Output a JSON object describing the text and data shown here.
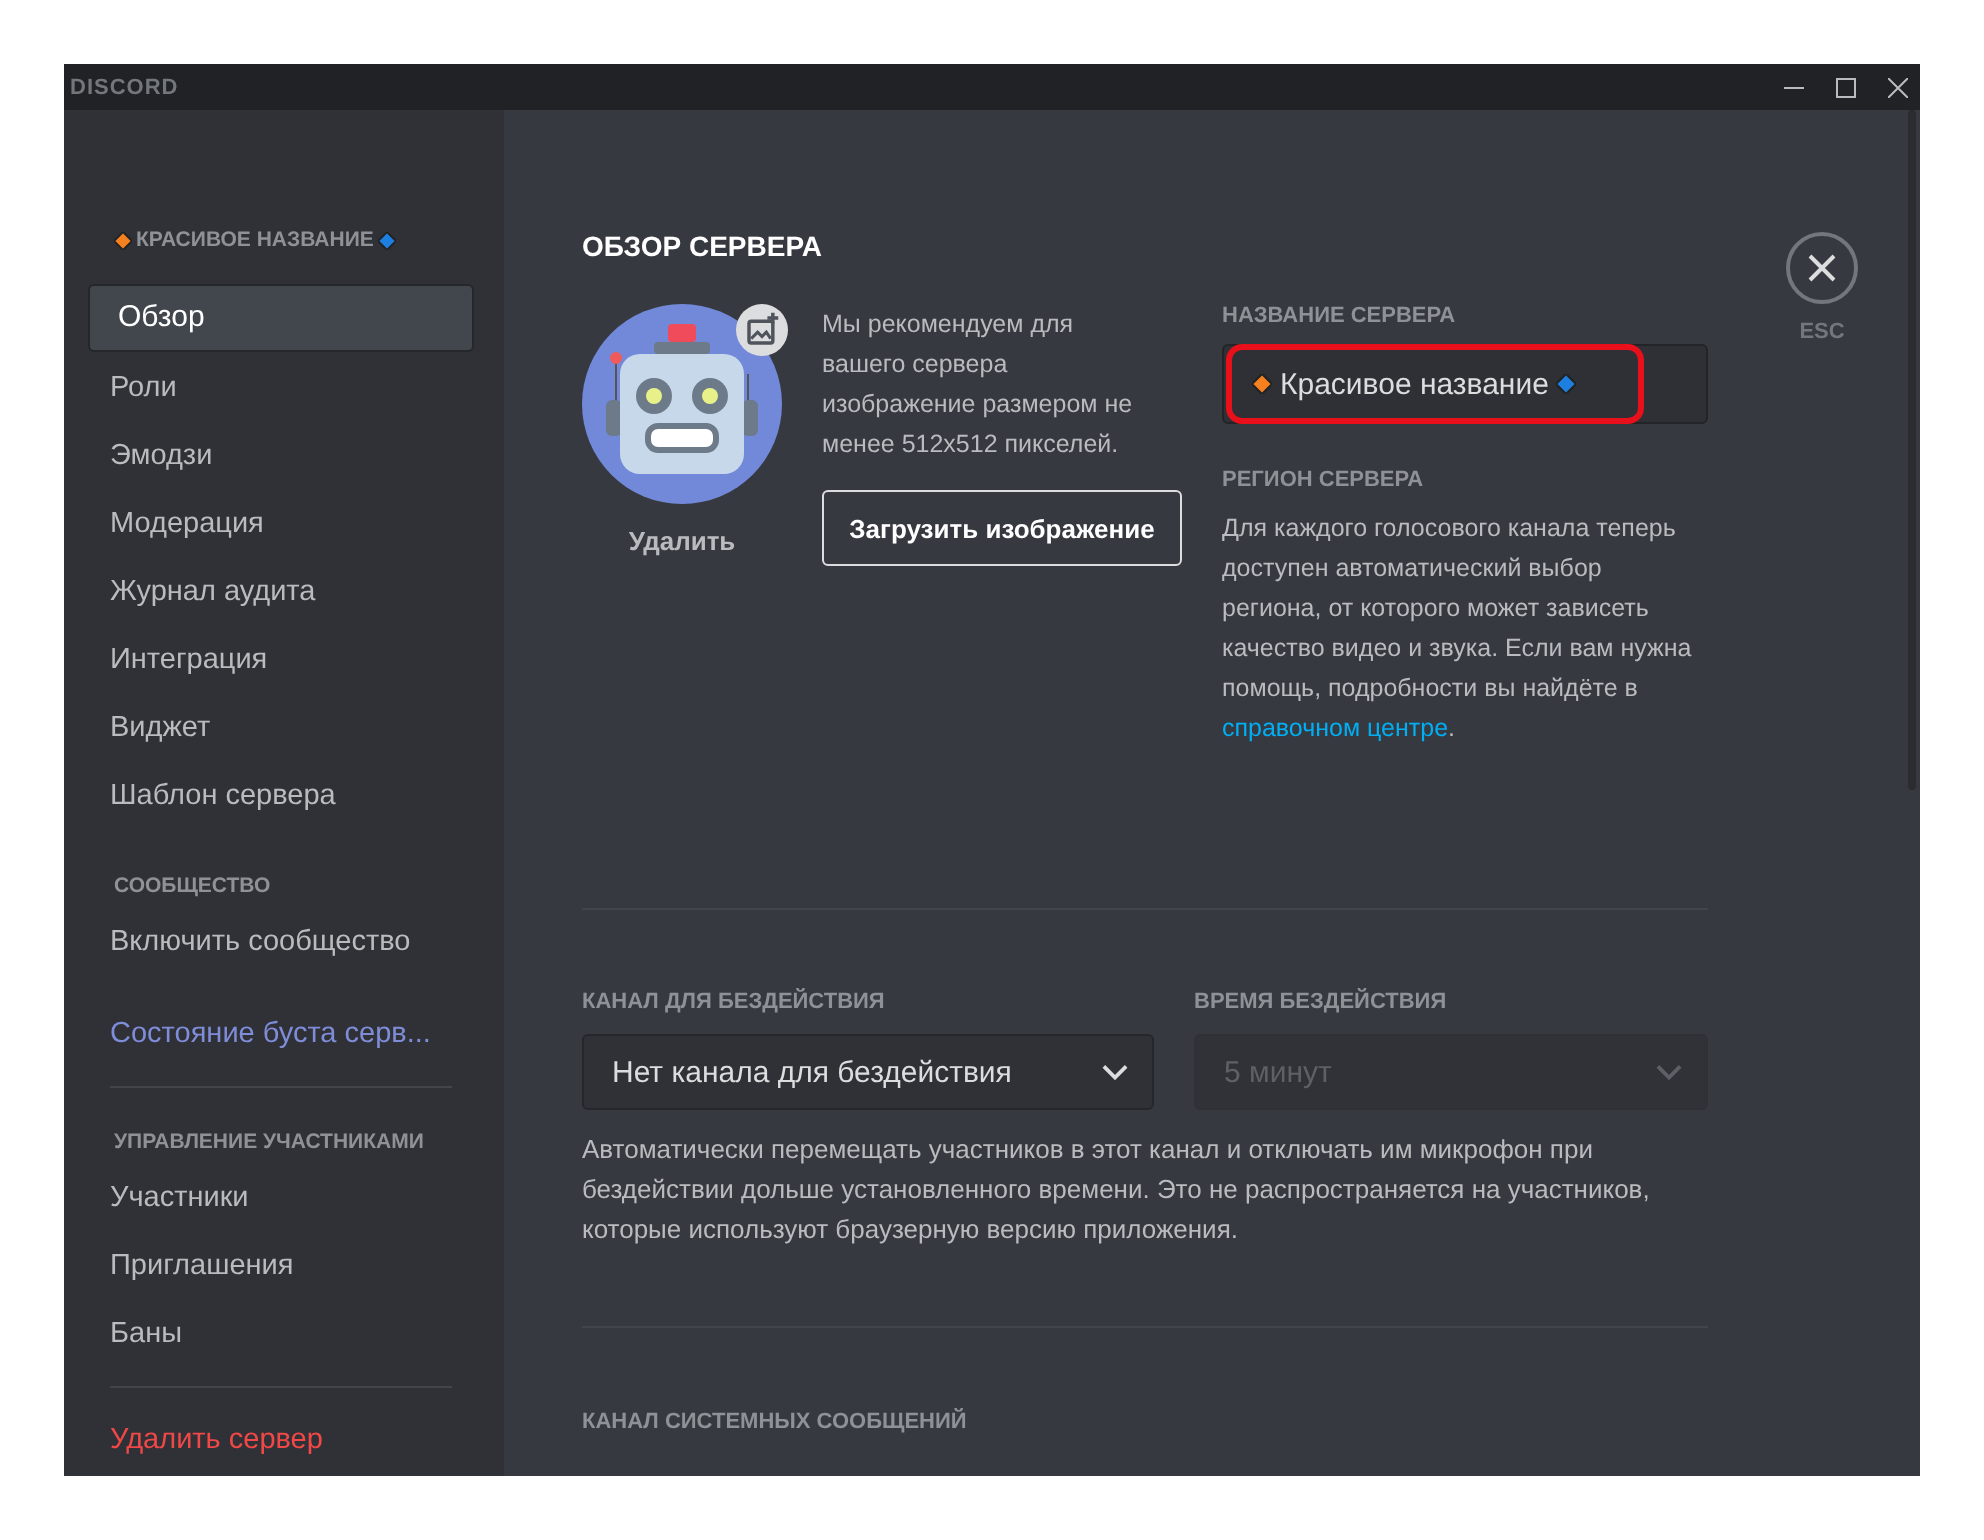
{
  "window": {
    "title": "DISCORD"
  },
  "sidebar": {
    "items": [
      {
        "kind": "header",
        "label": "КРАСИВОЕ НАЗВАНИЕ",
        "decorated": true
      },
      {
        "kind": "item",
        "label": "Обзор",
        "selected": true
      },
      {
        "kind": "item",
        "label": "Роли",
        "selected": false
      },
      {
        "kind": "item",
        "label": "Эмодзи",
        "selected": false
      },
      {
        "kind": "item",
        "label": "Модерация",
        "selected": false
      },
      {
        "kind": "item",
        "label": "Журнал аудита",
        "selected": false
      },
      {
        "kind": "item",
        "label": "Интеграция",
        "selected": false
      },
      {
        "kind": "item",
        "label": "Виджет",
        "selected": false
      },
      {
        "kind": "item",
        "label": "Шаблон сервера",
        "selected": false
      },
      {
        "kind": "header",
        "label": "СООБЩЕСТВО",
        "decorated": false
      },
      {
        "kind": "item",
        "label": "Включить сообщество",
        "selected": false
      },
      {
        "kind": "boost",
        "label": "Состояние буста серв...",
        "selected": false
      },
      {
        "kind": "divider"
      },
      {
        "kind": "header",
        "label": "УПРАВЛЕНИЕ УЧАСТНИКАМИ",
        "decorated": false
      },
      {
        "kind": "item",
        "label": "Участники",
        "selected": false
      },
      {
        "kind": "item",
        "label": "Приглашения",
        "selected": false
      },
      {
        "kind": "item",
        "label": "Баны",
        "selected": false
      },
      {
        "kind": "divider"
      },
      {
        "kind": "danger",
        "label": "Удалить сервер",
        "selected": false
      }
    ]
  },
  "overview": {
    "title": "ОБЗОР СЕРВЕРА",
    "remove_label": "Удалить",
    "hint": "Мы рекомендуем для вашего сервера изображение размером не менее 512x512 пикселей.",
    "upload_button": "Загрузить изображение",
    "name_label": "НАЗВАНИЕ СЕРВЕРА",
    "name_value": "Красивое название",
    "name_highlighted": true,
    "region_label": "РЕГИОН СЕРВЕРА",
    "region_text": "Для каждого голосового канала теперь доступен автоматический выбор региона, от которого может зависеть качество видео и звука. Если вам нужна помощь, подробности вы найдёте в",
    "region_link": "справочном центре",
    "region_end": "."
  },
  "close": {
    "label": "ESC"
  },
  "afk": {
    "channel_label": "КАНАЛ ДЛЯ БЕЗДЕЙСТВИЯ",
    "channel_value": "Нет канала для бездействия",
    "channel_disabled": false,
    "timeout_label": "ВРЕМЯ БЕЗДЕЙСТВИЯ",
    "timeout_value": "5 минут",
    "timeout_disabled": true,
    "description": "Автоматически перемещать участников в этот канал и отключать им микрофон при бездействии дольше установленного времени. Это не распространяется на участников, которые используют браузерную версию приложения."
  },
  "system_channel": {
    "label": "КАНАЛ СИСТЕМНЫХ СООБЩЕНИЙ"
  }
}
